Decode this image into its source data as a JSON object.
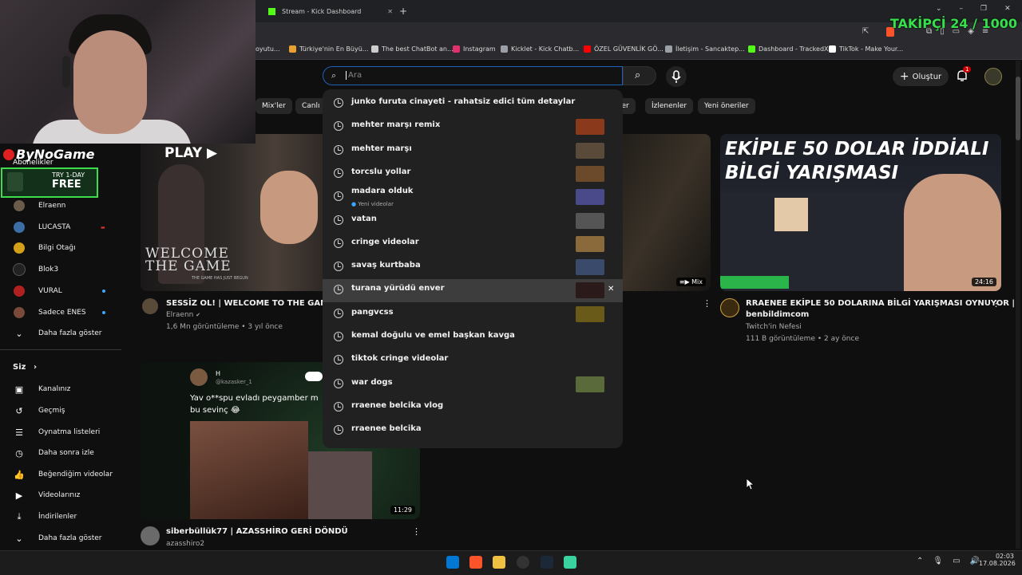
{
  "browser": {
    "tab_title": "Stream - Kick Dashboard",
    "new_tab": "+",
    "bookmarks": [
      {
        "label": "oyutu...",
        "color": "#ff0000"
      },
      {
        "label": "Türkiye'nin En Büyü...",
        "color": "#e8a030"
      },
      {
        "label": "The best ChatBot an...",
        "color": "#cccccc"
      },
      {
        "label": "Instagram",
        "color": "#e1306c"
      },
      {
        "label": "Kicklet - Kick Chatb...",
        "color": "#9aa0a6"
      },
      {
        "label": "ÖZEL GÜVENLİK GÖ...",
        "color": "#ff0000"
      },
      {
        "label": "İletişim - Sancaktep...",
        "color": "#9aa0a6"
      },
      {
        "label": "Dashboard - TrackedX",
        "color": "#53fc18"
      },
      {
        "label": "TikTok - Make Your...",
        "color": "#ffffff"
      }
    ]
  },
  "overlay": {
    "follower_goal": "TAKİPÇİ 24 / 1000",
    "brand": "ByNoGame",
    "trial_top": "TRY 1-DAY",
    "trial_main": "FREE"
  },
  "header": {
    "search_placeholder": "Ara",
    "create_label": "Oluştur",
    "notification_count": "1"
  },
  "chips": [
    "Mix'ler",
    "Canlı",
    "ler",
    "İzlenenler",
    "Yeni öneriler"
  ],
  "sidebar": {
    "subs_heading": "Abonelikler",
    "subscriptions": [
      {
        "label": "Elraenn",
        "color": "#6b5b4a",
        "live": false
      },
      {
        "label": "LUCASTA",
        "color": "#3a6ea5",
        "live": true
      },
      {
        "label": "Bilgi Otağı",
        "color": "#d4a017",
        "live": false
      },
      {
        "label": "Blok3",
        "color": "#222222",
        "live": false
      },
      {
        "label": "VURAL",
        "color": "#b02020",
        "live": true
      },
      {
        "label": "Sadece ENES",
        "color": "#7a4a3a",
        "live": true
      }
    ],
    "show_more": "Daha fazla göster",
    "you_heading": "Siz",
    "you_items": [
      "Kanalınız",
      "Geçmiş",
      "Oynatma listeleri",
      "Daha sonra izle",
      "Beğendiğim videolar",
      "Videolarınız",
      "İndirilenler",
      "Daha fazla göster"
    ]
  },
  "videos": {
    "v1": {
      "title": "SESSİZ OL! | WELCOME TO THE GAME 2",
      "channel": "Elraenn",
      "meta": "1,6 Mn görüntüleme • 3 yıl önce",
      "thumb_text_top": "PLAY ▶",
      "thumb_text_main": "WELCOME THE GAME",
      "thumb_text_sub": "THE GAME HAS JUST BEGUN"
    },
    "v3": {
      "badge": "Mix"
    },
    "v4": {
      "title_line1": "RRAENEE EKİPLE 50 DOLARINA BİLGİ YARIŞMASI OYNUYOR |",
      "title_line2": "benbildimcom",
      "channel": "Twitch'in Nefesi",
      "meta": "111 B görüntüleme • 2 ay önce",
      "duration": "24:16",
      "thumb_headline_1": "EKİPLE 50 DOLAR İDDİALI",
      "thumb_headline_2": "BİLGİ YARIŞMASI"
    },
    "v5": {
      "title": "siberbüllük77 | AZASSHİRO GERİ DÖNDÜ",
      "channel": "azasshiro2",
      "duration": "11:29",
      "tweet_name": "H",
      "tweet_handle": "@kazasker_1",
      "tweet_text_1": "Yav o**spu evladı peygamber m",
      "tweet_text_2": "bu sevinç 😂"
    }
  },
  "suggestions": [
    {
      "text": "junko furuta cinayeti - rahatsiz edici tüm detaylar",
      "thumb": null
    },
    {
      "text": "mehter marşı remix",
      "thumb": "#8a3a1a"
    },
    {
      "text": "mehter marşı",
      "thumb": "#5a4a3a"
    },
    {
      "text": "torcslu yollar",
      "thumb": "#6a4a2a"
    },
    {
      "text": "madara olduk",
      "thumb": "#4a4a8a",
      "sub": "Yeni videolar"
    },
    {
      "text": "vatan",
      "thumb": "#555555"
    },
    {
      "text": "cringe videolar",
      "thumb": "#8a6a3a"
    },
    {
      "text": "savaş kurtbaba",
      "thumb": "#3a4a6a"
    },
    {
      "text": "turana yürüdü enver",
      "thumb": "#2a1a1a",
      "highlighted": true
    },
    {
      "text": "pangvcss",
      "thumb": "#6a5a1a"
    },
    {
      "text": "kemal doğulu ve emel başkan kavga",
      "thumb": null
    },
    {
      "text": "tiktok cringe videolar",
      "thumb": null
    },
    {
      "text": "war dogs",
      "thumb": "#5a6a3a"
    },
    {
      "text": "rraenee belcika vlog",
      "thumb": null
    },
    {
      "text": "rraenee belcika",
      "thumb": null
    }
  ],
  "taskbar": {
    "time": "02:03",
    "date": "17.08.2026"
  }
}
